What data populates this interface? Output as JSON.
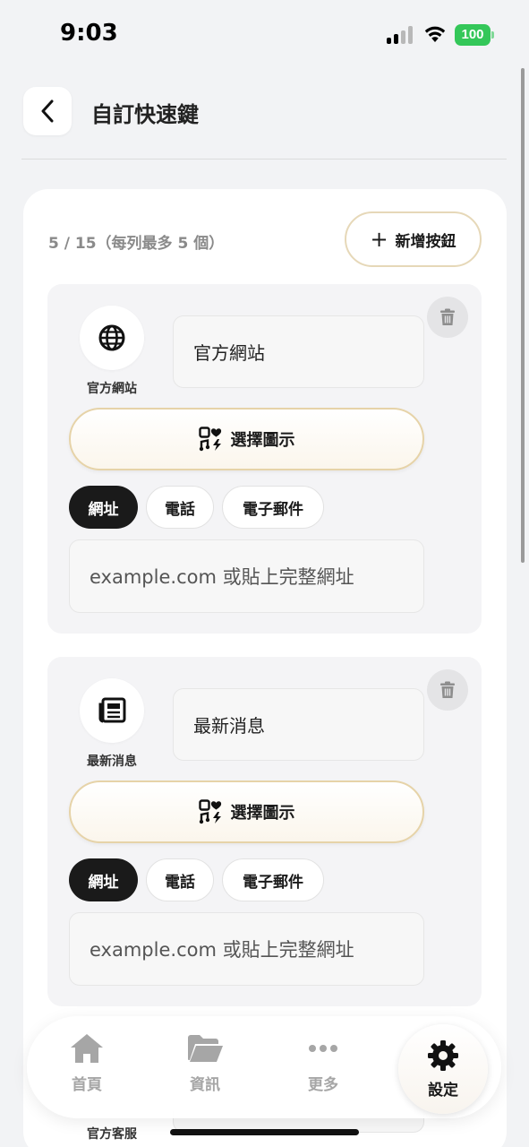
{
  "status_bar": {
    "time": "9:03",
    "battery": "100"
  },
  "header": {
    "title": "自訂快速鍵"
  },
  "panel": {
    "count_text": "5 / 15（每列最多 5 個）",
    "add_button": "新增按鈕"
  },
  "cards": [
    {
      "icon": "globe-icon",
      "caption": "官方網站",
      "name_value": "官方網站",
      "choose_icon_label": "選擇圖示",
      "chips": [
        "網址",
        "電話",
        "電子郵件"
      ],
      "active_chip": "網址",
      "url_placeholder": "example.com 或貼上完整網址"
    },
    {
      "icon": "newspaper-icon",
      "caption": "最新消息",
      "name_value": "最新消息",
      "choose_icon_label": "選擇圖示",
      "chips": [
        "網址",
        "電話",
        "電子郵件"
      ],
      "active_chip": "網址",
      "url_placeholder": "example.com 或貼上完整網址"
    }
  ],
  "partial_card": {
    "caption": "官方客服"
  },
  "tab_bar": {
    "tabs": [
      {
        "label": "首頁",
        "icon": "home-icon"
      },
      {
        "label": "資訊",
        "icon": "folder-icon"
      },
      {
        "label": "更多",
        "icon": "more-icon"
      },
      {
        "label": "設定",
        "icon": "gear-icon",
        "active": true
      }
    ]
  },
  "colors": {
    "accent_border": "#e6d3a8",
    "active_chip_bg": "#1a1a1a",
    "battery": "#34c759"
  }
}
